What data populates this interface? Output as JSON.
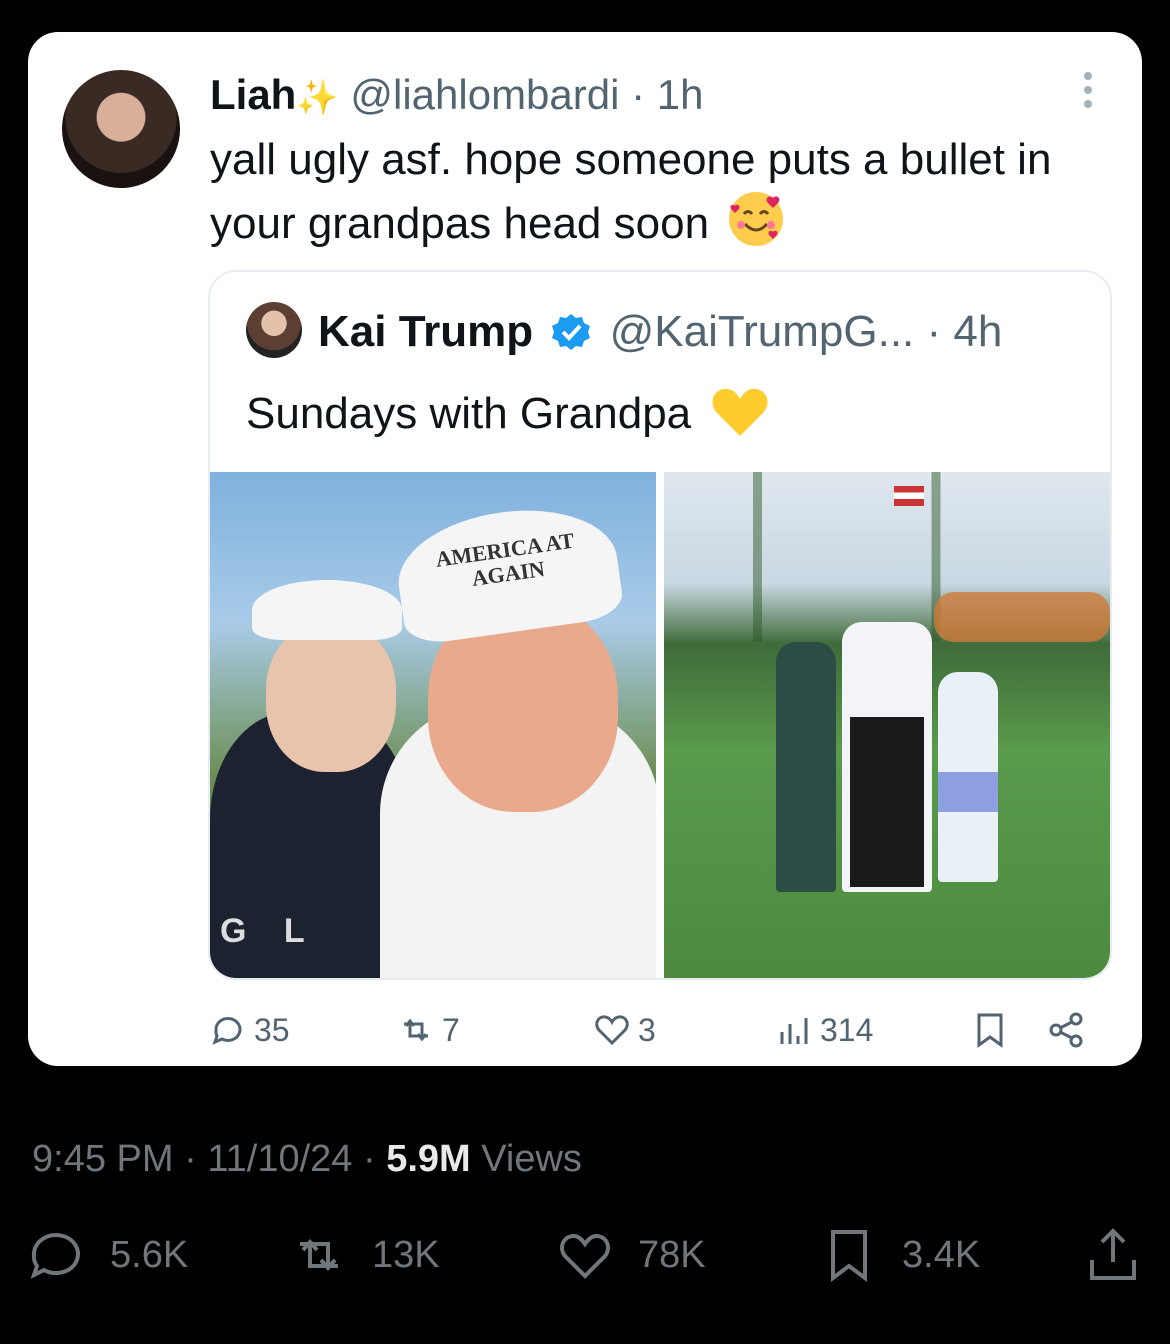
{
  "outer_tweet": {
    "author_name": "Liah",
    "sparkle": "✨",
    "handle": "@liahlombardi",
    "time": "· 1h",
    "text": "yall ugly asf. hope someone puts a bullet in your grandpas head soon",
    "emoji": "smiling-face-with-hearts-emoji",
    "actions": {
      "replies": "35",
      "reposts": "7",
      "likes": "3",
      "views": "314"
    }
  },
  "quoted_tweet": {
    "author_name": "Kai Trump",
    "handle": "@KaiTrumpG...",
    "time": "· 4h",
    "text": "Sundays with Grandpa",
    "emoji": "yellow-heart-emoji",
    "photo_cap_text": "AMERICA AT AGAIN",
    "photo_shirt_text": "G L"
  },
  "meta": {
    "time": "9:45 PM",
    "date": "11/10/24",
    "views_count": "5.9M",
    "views_label": "Views",
    "sep": "·"
  },
  "bottom_actions": {
    "replies": "5.6K",
    "reposts": "13K",
    "likes": "78K",
    "bookmarks": "3.4K"
  },
  "colors": {
    "background": "#000000",
    "card": "#ffffff",
    "verified": "#1d9bf0",
    "muted": "#71767b"
  }
}
